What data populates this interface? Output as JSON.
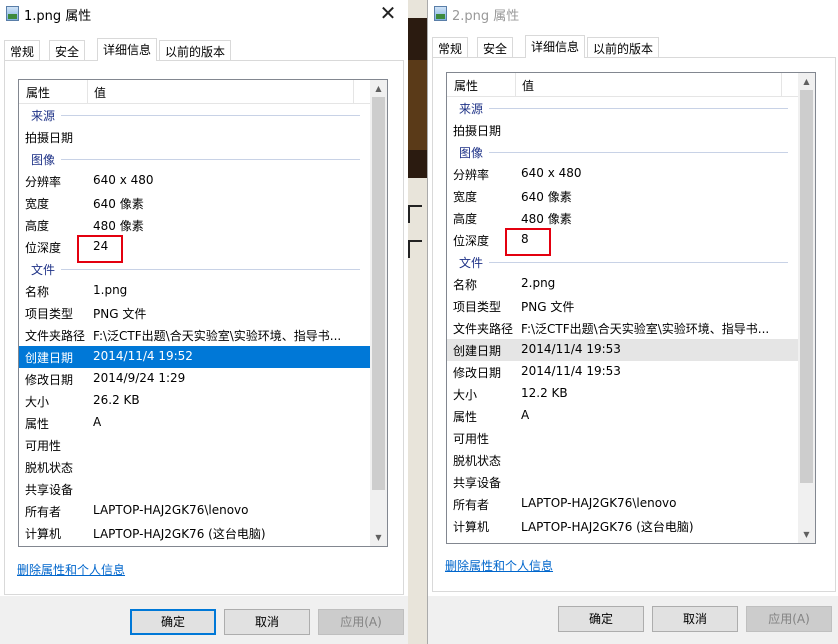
{
  "windows": [
    {
      "title": "1.png 属性",
      "close": "✕",
      "tabs": [
        "常规",
        "安全",
        "详细信息",
        "以前的版本"
      ],
      "active_tab": 2,
      "columns": {
        "property": "属性",
        "value": "值"
      },
      "rows": [
        {
          "type": "group",
          "label": "来源"
        },
        {
          "type": "row",
          "key": "拍摄日期",
          "value": ""
        },
        {
          "type": "group",
          "label": "图像"
        },
        {
          "type": "row",
          "key": "分辨率",
          "value": "640 x 480"
        },
        {
          "type": "row",
          "key": "宽度",
          "value": "640 像素"
        },
        {
          "type": "row",
          "key": "高度",
          "value": "480 像素"
        },
        {
          "type": "row",
          "key": "位深度",
          "value": "24"
        },
        {
          "type": "group",
          "label": "文件"
        },
        {
          "type": "row",
          "key": "名称",
          "value": "1.png"
        },
        {
          "type": "row",
          "key": "项目类型",
          "value": "PNG 文件"
        },
        {
          "type": "row",
          "key": "文件夹路径",
          "value": "F:\\泛CTF出题\\合天实验室\\实验环境、指导书..."
        },
        {
          "type": "row",
          "key": "创建日期",
          "value": "2014/11/4 19:52",
          "state": "selected"
        },
        {
          "type": "row",
          "key": "修改日期",
          "value": "2014/9/24 1:29"
        },
        {
          "type": "row",
          "key": "大小",
          "value": "26.2 KB"
        },
        {
          "type": "row",
          "key": "属性",
          "value": "A"
        },
        {
          "type": "row",
          "key": "可用性",
          "value": ""
        },
        {
          "type": "row",
          "key": "脱机状态",
          "value": ""
        },
        {
          "type": "row",
          "key": "共享设备",
          "value": ""
        },
        {
          "type": "row",
          "key": "所有者",
          "value": "LAPTOP-HAJ2GK76\\lenovo"
        },
        {
          "type": "row",
          "key": "计算机",
          "value": "LAPTOP-HAJ2GK76 (这台电脑)"
        }
      ],
      "remove_link": "删除属性和个人信息",
      "buttons": {
        "ok": "确定",
        "cancel": "取消",
        "apply": "应用(A)"
      }
    },
    {
      "title": "2.png 属性",
      "close": "✕",
      "tabs": [
        "常规",
        "安全",
        "详细信息",
        "以前的版本"
      ],
      "active_tab": 2,
      "columns": {
        "property": "属性",
        "value": "值"
      },
      "rows": [
        {
          "type": "group",
          "label": "来源"
        },
        {
          "type": "row",
          "key": "拍摄日期",
          "value": ""
        },
        {
          "type": "group",
          "label": "图像"
        },
        {
          "type": "row",
          "key": "分辨率",
          "value": "640 x 480"
        },
        {
          "type": "row",
          "key": "宽度",
          "value": "640 像素"
        },
        {
          "type": "row",
          "key": "高度",
          "value": "480 像素"
        },
        {
          "type": "row",
          "key": "位深度",
          "value": "8"
        },
        {
          "type": "group",
          "label": "文件"
        },
        {
          "type": "row",
          "key": "名称",
          "value": "2.png"
        },
        {
          "type": "row",
          "key": "项目类型",
          "value": "PNG 文件"
        },
        {
          "type": "row",
          "key": "文件夹路径",
          "value": "F:\\泛CTF出题\\合天实验室\\实验环境、指导书..."
        },
        {
          "type": "row",
          "key": "创建日期",
          "value": "2014/11/4 19:53",
          "state": "hover"
        },
        {
          "type": "row",
          "key": "修改日期",
          "value": "2014/11/4 19:53"
        },
        {
          "type": "row",
          "key": "大小",
          "value": "12.2 KB"
        },
        {
          "type": "row",
          "key": "属性",
          "value": "A"
        },
        {
          "type": "row",
          "key": "可用性",
          "value": ""
        },
        {
          "type": "row",
          "key": "脱机状态",
          "value": ""
        },
        {
          "type": "row",
          "key": "共享设备",
          "value": ""
        },
        {
          "type": "row",
          "key": "所有者",
          "value": "LAPTOP-HAJ2GK76\\lenovo"
        },
        {
          "type": "row",
          "key": "计算机",
          "value": "LAPTOP-HAJ2GK76 (这台电脑)"
        }
      ],
      "remove_link": "删除属性和个人信息",
      "buttons": {
        "ok": "确定",
        "cancel": "取消",
        "apply": "应用(A)"
      }
    }
  ],
  "colors": {
    "selection": "#0078d7",
    "group_text": "#1e3287",
    "highlight_box": "#e3000f",
    "link": "#0066cc"
  },
  "icons": {
    "title": "image-file-icon",
    "close": "close-icon",
    "scroll_up": "scroll-up-arrow-icon",
    "scroll_down": "scroll-down-arrow-icon"
  }
}
